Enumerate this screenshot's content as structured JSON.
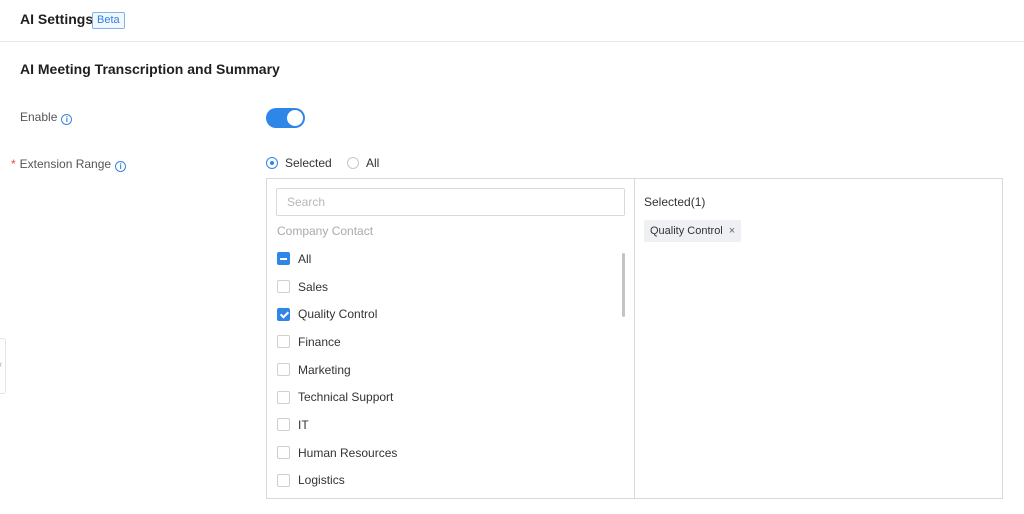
{
  "header": {
    "title": "AI Settings",
    "badge": "Beta"
  },
  "section": {
    "title": "AI Meeting Transcription and Summary"
  },
  "enable": {
    "label": "Enable",
    "info_icon": "info-icon",
    "value": true
  },
  "extension_range": {
    "label": "Extension Range",
    "required": "*",
    "info_icon": "info-icon",
    "options": [
      {
        "label": "Selected",
        "checked": true
      },
      {
        "label": "All",
        "checked": false
      }
    ]
  },
  "transfer": {
    "search_placeholder": "Search",
    "group_label": "Company Contact",
    "items": [
      {
        "label": "All",
        "state": "indeterminate"
      },
      {
        "label": "Sales",
        "state": "unchecked"
      },
      {
        "label": "Quality Control",
        "state": "checked"
      },
      {
        "label": "Finance",
        "state": "unchecked"
      },
      {
        "label": "Marketing",
        "state": "unchecked"
      },
      {
        "label": "Technical Support",
        "state": "unchecked"
      },
      {
        "label": "IT",
        "state": "unchecked"
      },
      {
        "label": "Human Resources",
        "state": "unchecked"
      },
      {
        "label": "Logistics",
        "state": "unchecked"
      }
    ],
    "selected_title": "Selected(1)",
    "selected_tags": [
      {
        "label": "Quality Control",
        "close": "×"
      }
    ]
  },
  "side_handle": {
    "glyph": "‹"
  },
  "colors": {
    "accent": "#2e86e8",
    "required": "#e5484d"
  }
}
